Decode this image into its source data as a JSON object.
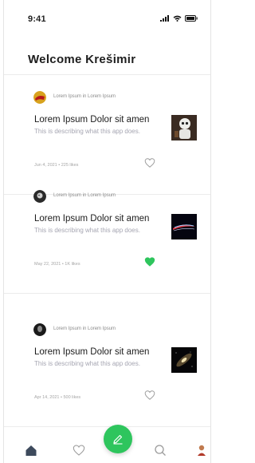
{
  "status": {
    "time": "9:41"
  },
  "header": {
    "title": "Welcome Krešimir"
  },
  "colors": {
    "accent": "#2ec55d",
    "like_inactive": "#9a9a9a"
  },
  "posts": [
    {
      "meta": "Lorem Ipsum in Lorem Ipsum",
      "title": "Lorem Ipsum Dolor sit amen",
      "description": "This is describing what this app does.",
      "date_likes": "Jun 4, 2021 • 225 likes",
      "liked": false
    },
    {
      "meta": "Lorem Ipsum in Lorem Ipsum",
      "title": "Lorem Ipsum Dolor sit amen",
      "description": "This is describing what this app does.",
      "date_likes": "May 22, 2021 • 1K likes",
      "liked": true
    },
    {
      "meta": "Lorem Ipsum in Lorem Ipsum",
      "title": "Lorem Ipsum Dolor sit amen",
      "description": "This is describing what this app does.",
      "date_likes": "Apr 14, 2021 • 500 likes",
      "liked": false
    }
  ],
  "tabbar": {
    "items": [
      "home-icon",
      "heart-icon",
      "compose-icon",
      "search-icon",
      "profile-avatar"
    ]
  }
}
